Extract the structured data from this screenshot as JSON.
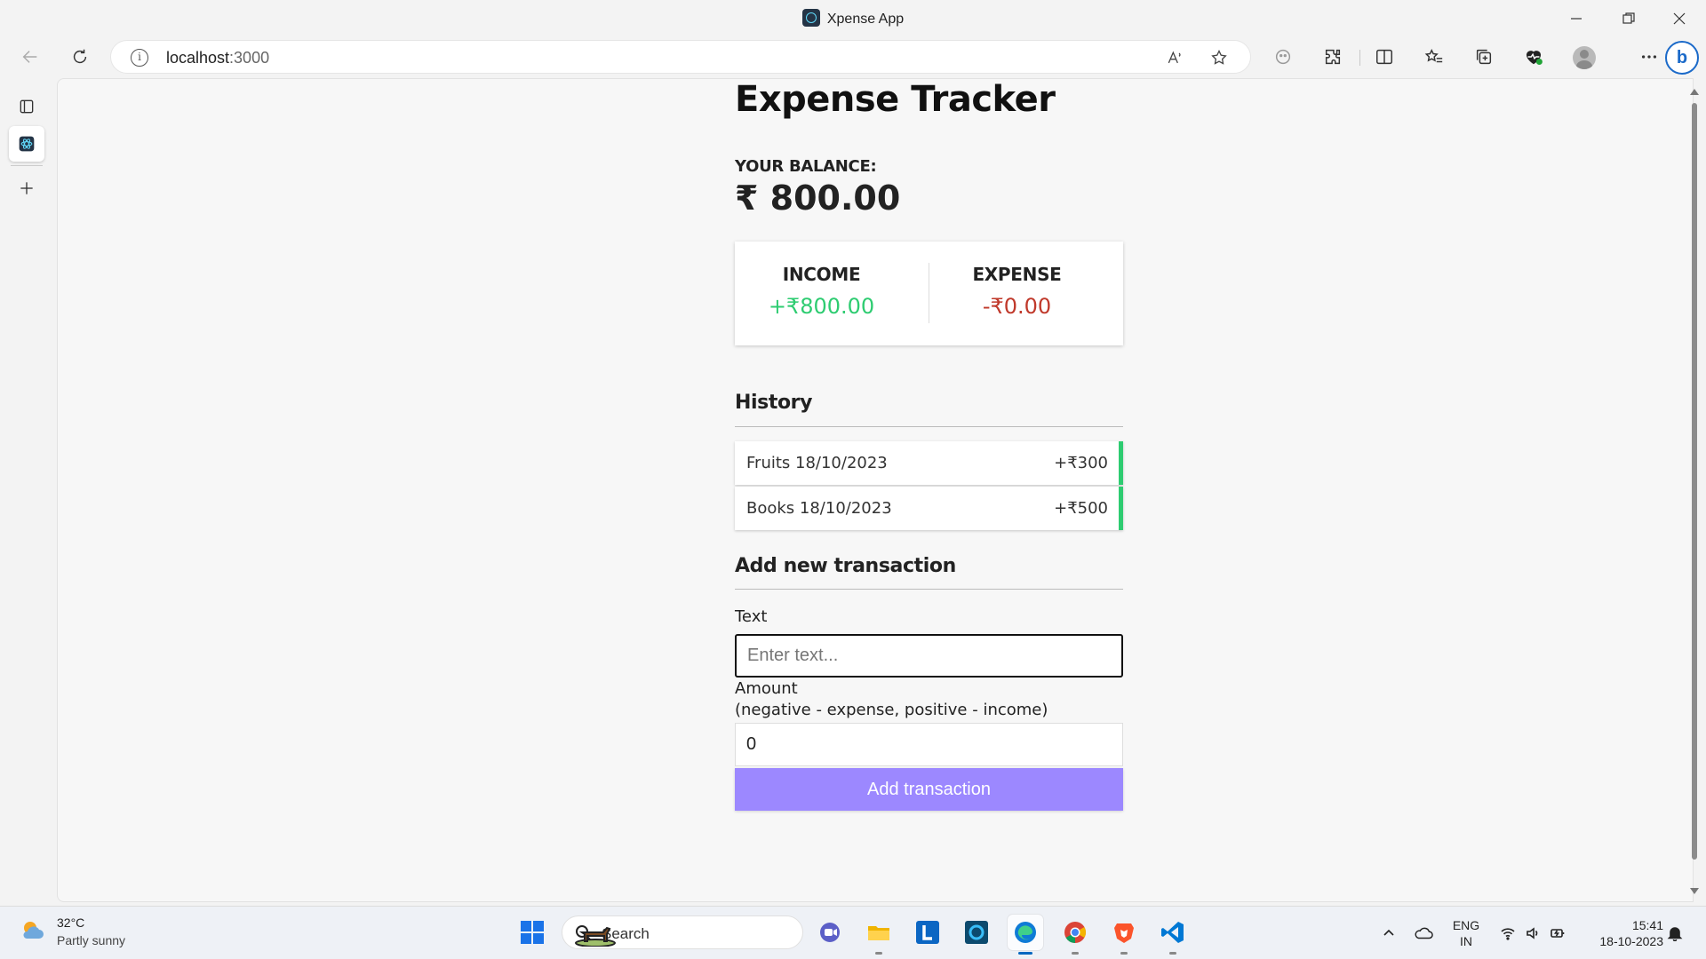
{
  "window": {
    "title": "Xpense App"
  },
  "browser": {
    "url_host": "localhost",
    "url_port": ":3000"
  },
  "app": {
    "title": "Expense Tracker",
    "balance_label": "YOUR BALANCE:",
    "balance_value": "₹ 800.00",
    "income_label": "INCOME",
    "income_value": "+₹800.00",
    "expense_label": "EXPENSE",
    "expense_value": "-₹0.00",
    "history_heading": "History",
    "transactions": [
      {
        "text": "Fruits 18/10/2023",
        "amount": "+₹300"
      },
      {
        "text": "Books 18/10/2023",
        "amount": "+₹500"
      }
    ],
    "add_heading": "Add new transaction",
    "text_label": "Text",
    "text_placeholder": "Enter text...",
    "amount_label": "Amount",
    "amount_hint": "(negative - expense, positive - income)",
    "amount_value": "0",
    "add_button": "Add transaction"
  },
  "colors": {
    "income": "#2ecc71",
    "expense": "#c0392b",
    "button": "#9c88ff"
  },
  "taskbar": {
    "weather_temp": "32°C",
    "weather_desc": "Partly sunny",
    "search_placeholder": "Search",
    "lang_top": "ENG",
    "lang_bottom": "IN",
    "time": "15:41",
    "date": "18-10-2023"
  }
}
